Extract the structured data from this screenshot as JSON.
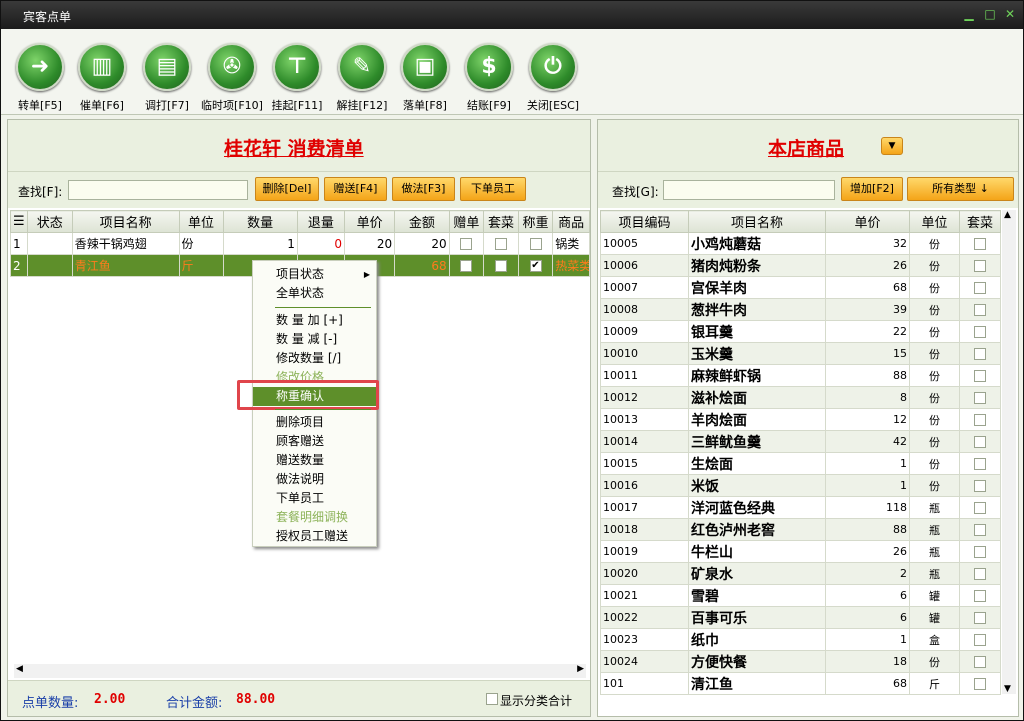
{
  "window": {
    "title": "宾客点单",
    "min": "▁",
    "max": "□",
    "close": "✕"
  },
  "toolbar": [
    {
      "label": "转单[F5]",
      "glyph": "➜",
      "icon": "forward-arrow-icon"
    },
    {
      "label": "催单[F6]",
      "glyph": "▥",
      "icon": "building-icon"
    },
    {
      "label": "调打[F7]",
      "glyph": "▤",
      "icon": "document-icon"
    },
    {
      "label": "临时项[F10]",
      "glyph": "✇",
      "icon": "fork-spoon-icon"
    },
    {
      "label": "挂起[F11]",
      "glyph": "⊤",
      "icon": "tie-icon"
    },
    {
      "label": "解挂[F12]",
      "glyph": "✎",
      "icon": "untie-icon"
    },
    {
      "label": "落单[F8]",
      "glyph": "▣",
      "icon": "order-icon"
    },
    {
      "label": "结账[F9]",
      "glyph": "$",
      "icon": "dollar-icon"
    },
    {
      "label": "关闭[ESC]",
      "glyph": "⏻",
      "icon": "power-icon"
    }
  ],
  "left": {
    "title": "桂花轩  消费清单",
    "search_label": "查找[F]:",
    "search_value": "",
    "buttons": [
      "删除[Del]",
      "赠送[F4]",
      "做法[F3]",
      "下单员工"
    ],
    "columns": [
      "☰",
      "状态",
      "项目名称",
      "单位",
      "数量",
      "退量",
      "单价",
      "金额",
      "赠单",
      "套菜",
      "称重",
      "商品"
    ],
    "rows": [
      {
        "no": "1",
        "status": "",
        "name": "香辣干锅鸡翅",
        "unit": "份",
        "qty": "1",
        "ret": "0",
        "price": "20",
        "amount": "20",
        "gift": false,
        "set": false,
        "weigh": false,
        "cat": "锅类"
      },
      {
        "no": "2",
        "status": "",
        "name": "青江鱼",
        "unit": "斤",
        "qty": "",
        "ret": "",
        "price": "",
        "amount": "68",
        "gift": false,
        "set": false,
        "weigh": true,
        "cat": "热菜类"
      }
    ],
    "footer": {
      "count_label": "点单数量:",
      "count": "2.00",
      "total_label": "合计金额:",
      "total": "88.00",
      "show_cat": "显示分类合计"
    }
  },
  "context_menu": {
    "items": [
      {
        "label": "项目状态",
        "arrow": "▶"
      },
      {
        "label": "全单状态"
      },
      {
        "label": "数 量 加 [+]"
      },
      {
        "label": "数 量 减 [-]"
      },
      {
        "label": "修改数量 [/]"
      },
      {
        "label": "修改价格",
        "disabled": true
      },
      {
        "label": "称重确认",
        "highlight": true
      },
      {
        "label": "删除项目"
      },
      {
        "label": "顾客赠送"
      },
      {
        "label": "赠送数量"
      },
      {
        "label": "做法说明"
      },
      {
        "label": "下单员工"
      },
      {
        "label": "套餐明细调换",
        "disabled": true
      },
      {
        "label": "授权员工赠送"
      }
    ]
  },
  "right": {
    "title": "本店商品",
    "search_label": "查找[G]:",
    "search_value": "",
    "add_button": "增加[F2]",
    "type_button": "所有类型 ↓",
    "columns": [
      "项目编码",
      "项目名称",
      "单价",
      "单位",
      "套菜"
    ],
    "rows": [
      {
        "code": "10005",
        "name": "小鸡炖蘑菇",
        "price": "32",
        "unit": "份"
      },
      {
        "code": "10006",
        "name": "猪肉炖粉条",
        "price": "26",
        "unit": "份"
      },
      {
        "code": "10007",
        "name": "宫保羊肉",
        "price": "68",
        "unit": "份"
      },
      {
        "code": "10008",
        "name": "葱拌牛肉",
        "price": "39",
        "unit": "份"
      },
      {
        "code": "10009",
        "name": "银耳羹",
        "price": "22",
        "unit": "份"
      },
      {
        "code": "10010",
        "name": "玉米羹",
        "price": "15",
        "unit": "份"
      },
      {
        "code": "10011",
        "name": "麻辣鲜虾锅",
        "price": "88",
        "unit": "份"
      },
      {
        "code": "10012",
        "name": "滋补烩面",
        "price": "8",
        "unit": "份"
      },
      {
        "code": "10013",
        "name": "羊肉烩面",
        "price": "12",
        "unit": "份"
      },
      {
        "code": "10014",
        "name": "三鲜鱿鱼羹",
        "price": "42",
        "unit": "份"
      },
      {
        "code": "10015",
        "name": "生烩面",
        "price": "1",
        "unit": "份"
      },
      {
        "code": "10016",
        "name": "米饭",
        "price": "1",
        "unit": "份"
      },
      {
        "code": "10017",
        "name": "洋河蓝色经典",
        "price": "118",
        "unit": "瓶"
      },
      {
        "code": "10018",
        "name": "红色泸州老窖",
        "price": "88",
        "unit": "瓶"
      },
      {
        "code": "10019",
        "name": "牛栏山",
        "price": "26",
        "unit": "瓶"
      },
      {
        "code": "10020",
        "name": "矿泉水",
        "price": "2",
        "unit": "瓶"
      },
      {
        "code": "10021",
        "name": "雪碧",
        "price": "6",
        "unit": "罐"
      },
      {
        "code": "10022",
        "name": "百事可乐",
        "price": "6",
        "unit": "罐"
      },
      {
        "code": "10023",
        "name": "纸巾",
        "price": "1",
        "unit": "盒"
      },
      {
        "code": "10024",
        "name": "方便快餐",
        "price": "18",
        "unit": "份"
      },
      {
        "code": "101",
        "name": "清江鱼",
        "price": "68",
        "unit": "斤"
      }
    ]
  }
}
